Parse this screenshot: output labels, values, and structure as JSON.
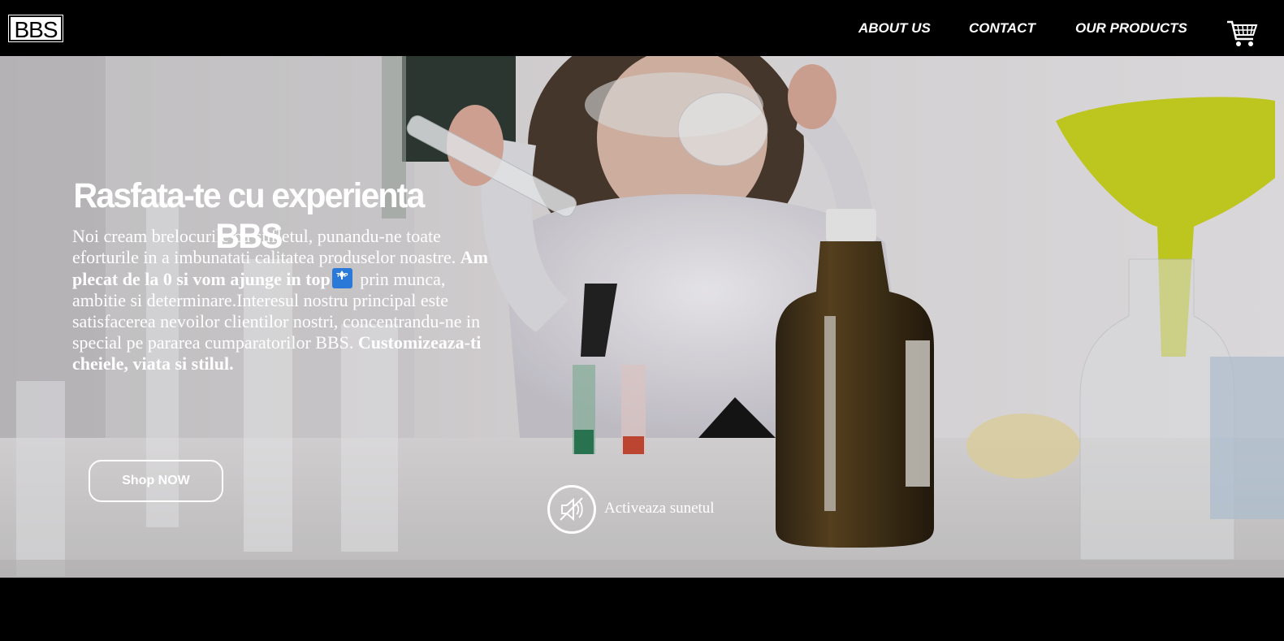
{
  "navbar": {
    "logo": "BBS",
    "links": [
      "ABOUT US",
      "CONTACT",
      "OUR PRODUCTS"
    ],
    "cart_icon": "shopping-cart-icon"
  },
  "hero": {
    "headline_line1": "Rasfata-te cu experienta",
    "headline_line2": "BBS",
    "body_part1": "Noi cream brelocurile cu sufletul, punandu-ne toate eforturile in a imbunatati calitatea produselor noastre. ",
    "body_bold1": "Am plecat de la 0 si vom ajunge in top",
    "top_badge": "TOP",
    "body_part2": " prin munca, ambitie si determinare.Interesul nostru principal este satisfacerea nevoilor clientilor nostri, concentrandu-ne in special pe pararea cumparatorilor BBS. ",
    "body_bold2": "Customizeaza-ti cheiele, viata si stilul.",
    "shop_button": "Shop NOW",
    "sound_label": "Activeaza sunetul",
    "sound_icon": "speaker-muted-icon"
  },
  "colors": {
    "navbar_bg": "#000000",
    "text": "#ffffff",
    "badge": "#2a78d8"
  }
}
